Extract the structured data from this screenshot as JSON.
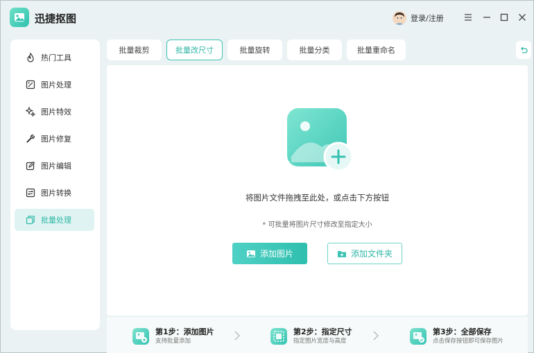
{
  "app": {
    "title": "迅捷抠图",
    "login_label": "登录/注册",
    "accent_color": "#2fb6a6"
  },
  "window_controls": {
    "icons": [
      "menu-icon",
      "minimize-icon",
      "maximize-icon",
      "close-icon"
    ]
  },
  "sidebar": {
    "items": [
      {
        "label": "热门工具",
        "icon": "flame-icon",
        "active": false
      },
      {
        "label": "图片处理",
        "icon": "image-edit-icon",
        "active": false
      },
      {
        "label": "图片特效",
        "icon": "sparkle-icon",
        "active": false
      },
      {
        "label": "图片修复",
        "icon": "wrench-icon",
        "active": false
      },
      {
        "label": "图片编辑",
        "icon": "pencil-icon",
        "active": false
      },
      {
        "label": "图片转换",
        "icon": "convert-icon",
        "active": false
      },
      {
        "label": "批量处理",
        "icon": "batch-icon",
        "active": true
      }
    ]
  },
  "tabs": [
    {
      "label": "批量裁剪",
      "active": false
    },
    {
      "label": "批量改尺寸",
      "active": true
    },
    {
      "label": "批量旋转",
      "active": false
    },
    {
      "label": "批量分类",
      "active": false
    },
    {
      "label": "批量重命名",
      "active": false
    }
  ],
  "main": {
    "drop_hint": "将图片文件拖拽至此处，或点击下方按钮",
    "sub_hint": "* 可批量将图片尺寸修改至指定大小",
    "add_image_label": "添加图片",
    "add_folder_label": "添加文件夹"
  },
  "steps": [
    {
      "title": "第1步：添加图片",
      "desc": "支持批量添加"
    },
    {
      "title": "第2步：指定尺寸",
      "desc": "指定图片宽度与高度"
    },
    {
      "title": "第3步：全部保存",
      "desc": "点击保存按钮即可保存图片"
    }
  ]
}
